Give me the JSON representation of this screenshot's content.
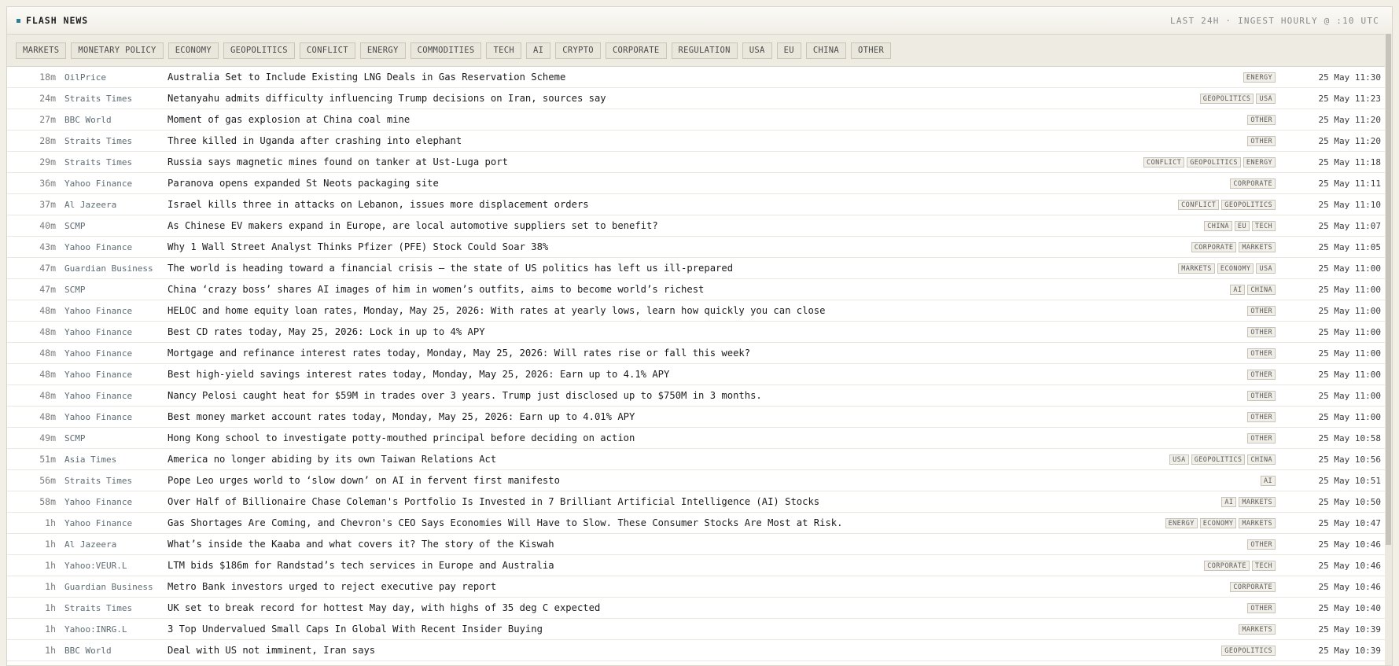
{
  "header": {
    "title": "FLASH NEWS",
    "meta": "LAST 24H · INGEST HOURLY @ :10 UTC"
  },
  "filters": [
    "MARKETS",
    "MONETARY POLICY",
    "ECONOMY",
    "GEOPOLITICS",
    "CONFLICT",
    "ENERGY",
    "COMMODITIES",
    "TECH",
    "AI",
    "CRYPTO",
    "CORPORATE",
    "REGULATION",
    "USA",
    "EU",
    "CHINA",
    "OTHER"
  ],
  "rows": [
    {
      "age": "18m",
      "source": "OilPrice",
      "headline": "Australia Set to Include Existing LNG Deals in Gas Reservation Scheme",
      "tags": [
        "ENERGY"
      ],
      "time": "25 May 11:30"
    },
    {
      "age": "24m",
      "source": "Straits Times",
      "headline": "Netanyahu admits difficulty influencing Trump decisions on Iran, sources say",
      "tags": [
        "GEOPOLITICS",
        "USA"
      ],
      "time": "25 May 11:23"
    },
    {
      "age": "27m",
      "source": "BBC World",
      "headline": "Moment of gas explosion at China coal mine",
      "tags": [
        "OTHER"
      ],
      "time": "25 May 11:20"
    },
    {
      "age": "28m",
      "source": "Straits Times",
      "headline": "Three killed in Uganda after crashing into elephant",
      "tags": [
        "OTHER"
      ],
      "time": "25 May 11:20"
    },
    {
      "age": "29m",
      "source": "Straits Times",
      "headline": "Russia says magnetic mines found on tanker at Ust-Luga port",
      "tags": [
        "CONFLICT",
        "GEOPOLITICS",
        "ENERGY"
      ],
      "time": "25 May 11:18"
    },
    {
      "age": "36m",
      "source": "Yahoo Finance",
      "headline": "Paranova opens expanded St Neots packaging site",
      "tags": [
        "CORPORATE"
      ],
      "time": "25 May 11:11"
    },
    {
      "age": "37m",
      "source": "Al Jazeera",
      "headline": "Israel kills three in attacks on Lebanon, issues more displacement orders",
      "tags": [
        "CONFLICT",
        "GEOPOLITICS"
      ],
      "time": "25 May 11:10"
    },
    {
      "age": "40m",
      "source": "SCMP",
      "headline": "As Chinese EV makers expand in Europe, are local automotive suppliers set to benefit?",
      "tags": [
        "CHINA",
        "EU",
        "TECH"
      ],
      "time": "25 May 11:07"
    },
    {
      "age": "43m",
      "source": "Yahoo Finance",
      "headline": "Why 1 Wall Street Analyst Thinks Pfizer (PFE) Stock Could Soar 38%",
      "tags": [
        "CORPORATE",
        "MARKETS"
      ],
      "time": "25 May 11:05"
    },
    {
      "age": "47m",
      "source": "Guardian Business",
      "headline": "The world is heading toward a financial crisis – the state of US politics has left us ill-prepared",
      "tags": [
        "MARKETS",
        "ECONOMY",
        "USA"
      ],
      "time": "25 May 11:00"
    },
    {
      "age": "47m",
      "source": "SCMP",
      "headline": "China ‘crazy boss’ shares AI images of him in women’s outfits, aims to become world’s richest",
      "tags": [
        "AI",
        "CHINA"
      ],
      "time": "25 May 11:00"
    },
    {
      "age": "48m",
      "source": "Yahoo Finance",
      "headline": "HELOC and home equity loan rates, Monday, May 25, 2026: With rates at yearly lows, learn how quickly you can close",
      "tags": [
        "OTHER"
      ],
      "time": "25 May 11:00"
    },
    {
      "age": "48m",
      "source": "Yahoo Finance",
      "headline": "Best CD rates today, May 25, 2026: Lock in up to 4% APY",
      "tags": [
        "OTHER"
      ],
      "time": "25 May 11:00"
    },
    {
      "age": "48m",
      "source": "Yahoo Finance",
      "headline": "Mortgage and refinance interest rates today, Monday, May 25, 2026: Will rates rise or fall this week?",
      "tags": [
        "OTHER"
      ],
      "time": "25 May 11:00"
    },
    {
      "age": "48m",
      "source": "Yahoo Finance",
      "headline": "Best high-yield savings interest rates today, Monday, May 25, 2026: Earn up to 4.1% APY",
      "tags": [
        "OTHER"
      ],
      "time": "25 May 11:00"
    },
    {
      "age": "48m",
      "source": "Yahoo Finance",
      "headline": "Nancy Pelosi caught heat for $59M in trades over 3 years. Trump just disclosed up to $750M in 3 months.",
      "tags": [
        "OTHER"
      ],
      "time": "25 May 11:00"
    },
    {
      "age": "48m",
      "source": "Yahoo Finance",
      "headline": "Best money market account rates today, Monday, May 25, 2026: Earn up to 4.01% APY",
      "tags": [
        "OTHER"
      ],
      "time": "25 May 11:00"
    },
    {
      "age": "49m",
      "source": "SCMP",
      "headline": "Hong Kong school to investigate potty-mouthed principal before deciding on action",
      "tags": [
        "OTHER"
      ],
      "time": "25 May 10:58"
    },
    {
      "age": "51m",
      "source": "Asia Times",
      "headline": "America no longer abiding by its own Taiwan Relations Act",
      "tags": [
        "USA",
        "GEOPOLITICS",
        "CHINA"
      ],
      "time": "25 May 10:56"
    },
    {
      "age": "56m",
      "source": "Straits Times",
      "headline": "Pope Leo urges world to ‘slow down’ on AI in fervent first manifesto",
      "tags": [
        "AI"
      ],
      "time": "25 May 10:51"
    },
    {
      "age": "58m",
      "source": "Yahoo Finance",
      "headline": "Over Half of Billionaire Chase Coleman's Portfolio Is Invested in 7 Brilliant Artificial Intelligence (AI) Stocks",
      "tags": [
        "AI",
        "MARKETS"
      ],
      "time": "25 May 10:50"
    },
    {
      "age": "1h",
      "source": "Yahoo Finance",
      "headline": "Gas Shortages Are Coming, and Chevron's CEO Says Economies Will Have to Slow. These Consumer Stocks Are Most at Risk.",
      "tags": [
        "ENERGY",
        "ECONOMY",
        "MARKETS"
      ],
      "time": "25 May 10:47"
    },
    {
      "age": "1h",
      "source": "Al Jazeera",
      "headline": "What’s inside the Kaaba and what covers it? The story of the Kiswah",
      "tags": [
        "OTHER"
      ],
      "time": "25 May 10:46"
    },
    {
      "age": "1h",
      "source": "Yahoo:VEUR.L",
      "headline": "LTM bids $186m for Randstad’s tech services in Europe and Australia",
      "tags": [
        "CORPORATE",
        "TECH"
      ],
      "time": "25 May 10:46"
    },
    {
      "age": "1h",
      "source": "Guardian Business",
      "headline": "Metro Bank investors urged to reject executive pay report",
      "tags": [
        "CORPORATE"
      ],
      "time": "25 May 10:46"
    },
    {
      "age": "1h",
      "source": "Straits Times",
      "headline": "UK set to break record for hottest May day, with highs of 35 deg C expected",
      "tags": [
        "OTHER"
      ],
      "time": "25 May 10:40"
    },
    {
      "age": "1h",
      "source": "Yahoo:INRG.L",
      "headline": "3 Top Undervalued Small Caps In Global With Recent Insider Buying",
      "tags": [
        "MARKETS"
      ],
      "time": "25 May 10:39"
    },
    {
      "age": "1h",
      "source": "BBC World",
      "headline": "Deal with US not imminent, Iran says",
      "tags": [
        "GEOPOLITICS"
      ],
      "time": "25 May 10:39"
    }
  ]
}
